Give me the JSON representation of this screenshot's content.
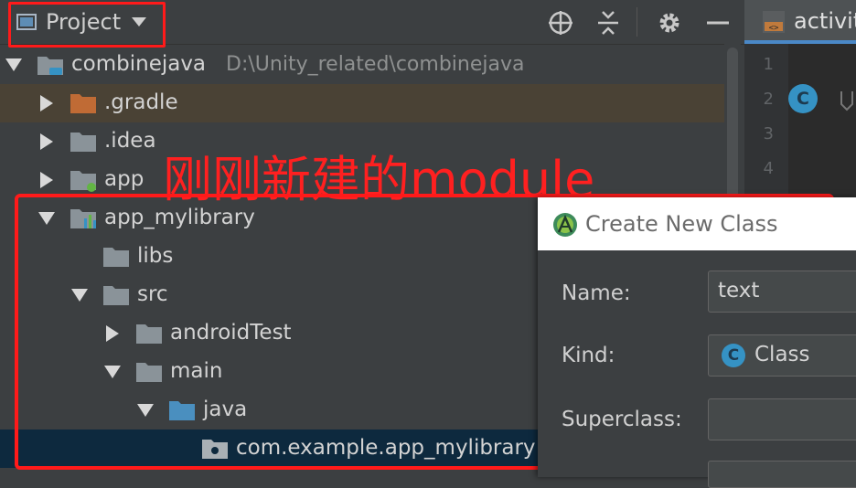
{
  "toolbar": {
    "project_label": "Project",
    "icons": [
      "target-icon",
      "collapse-icon",
      "gear-icon",
      "minimize-icon"
    ]
  },
  "editor": {
    "tab_label": "activit",
    "line_numbers": [
      "1",
      "2",
      "3",
      "4"
    ],
    "class_badge": "C"
  },
  "tree": {
    "root": {
      "name": "combinejava",
      "path": "D:\\Unity_related\\combinejava"
    },
    "gradle": ".gradle",
    "idea": ".idea",
    "app": "app",
    "module": "app_mylibrary",
    "libs": "libs",
    "src": "src",
    "android_test": "androidTest",
    "main": "main",
    "java": "java",
    "package": "com.example.app_mylibrary"
  },
  "annotation": {
    "text": "刚刚新建的module",
    "color": "#ff1a1a"
  },
  "dialog": {
    "title": "Create New Class",
    "name_label": "Name:",
    "name_value": "text",
    "kind_label": "Kind:",
    "kind_value": "Class",
    "kind_badge": "C",
    "superclass_label": "Superclass:",
    "superclass_value": ""
  },
  "colors": {
    "background": "#3c3f41",
    "selection": "#0d293e",
    "accent": "#4a88c7",
    "folder": "#8a9399",
    "gradle_folder": "#c06b35",
    "java_folder": "#4a8fbf"
  }
}
